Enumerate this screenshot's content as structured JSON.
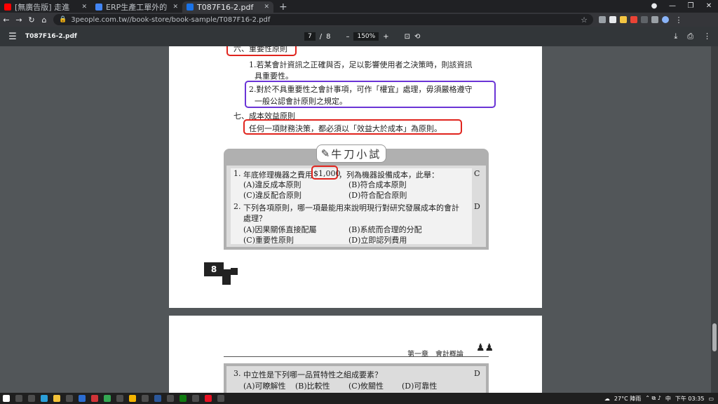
{
  "browser": {
    "tabs": [
      {
        "label": "[無廣告版] 走進",
        "active": false,
        "color": "#ff0000"
      },
      {
        "label": "ERP生產工單外的",
        "active": false,
        "color": "#4285f4"
      },
      {
        "label": "T087F16-2.pdf",
        "active": true,
        "color": "#1a73e8"
      }
    ],
    "new_tab": "+",
    "url": "3people.com.tw//book-store/book-sample/T087F16-2.pdf"
  },
  "pdf_toolbar": {
    "title": "T087F16-2.pdf",
    "current_page": "7",
    "total_pages": "8",
    "page_sep": "/",
    "zoom": "150%",
    "zoom_out": "–",
    "zoom_in": "+"
  },
  "page1": {
    "section6_title": "六、重要性原則",
    "item1_line1": "1.若某會計資訊之正確與否，足以影響使用者之決策時，則該資訊",
    "item1_line2": "具重要性。",
    "item2_line1": "2.對於不具重要性之會計事項，可作「權宜」處理，毋須嚴格遵守",
    "item2_line2": "一般公認會計原則之規定。",
    "section7_title": "七、成本效益原則",
    "section7_body": "任何一項財務決策，都必須以「效益大於成本」為原則。",
    "quiz_title": "牛刀小試",
    "q1_num": "1.",
    "q1_text_a": "年底修理機器之費用",
    "q1_amount": "$1,000",
    "q1_text_b": "，列為機器設備成本，此舉：",
    "q1_answer": "C",
    "q1_opts": [
      "(A)違反成本原則",
      "(B)符合成本原則",
      "(C)違反配合原則",
      "(D)符合配合原則"
    ],
    "q2_num": "2.",
    "q2_line1": "下列各項原則，哪一項最能用來說明現行對研究發展成本的會計",
    "q2_line2": "處理？",
    "q2_answer": "D",
    "q2_opts": [
      "(A)因果關係直接配屬",
      "(B)系統而合理的分配",
      "(C)重要性原則",
      "(D)立即認列費用"
    ],
    "page_number": "8"
  },
  "page2": {
    "chapter": "第一章　會計概論",
    "q3_num": "3.",
    "q3_text": "中立性是下列哪一品質特性之組成要素？",
    "q3_answer": "D",
    "q3_opts": [
      "(A)可瞭解性",
      "(B)比較性",
      "(C)攸關性",
      "(D)可靠性"
    ]
  },
  "taskbar": {
    "weather": "27°C 陣雨",
    "ime": "中",
    "time": "下午 03:35"
  }
}
